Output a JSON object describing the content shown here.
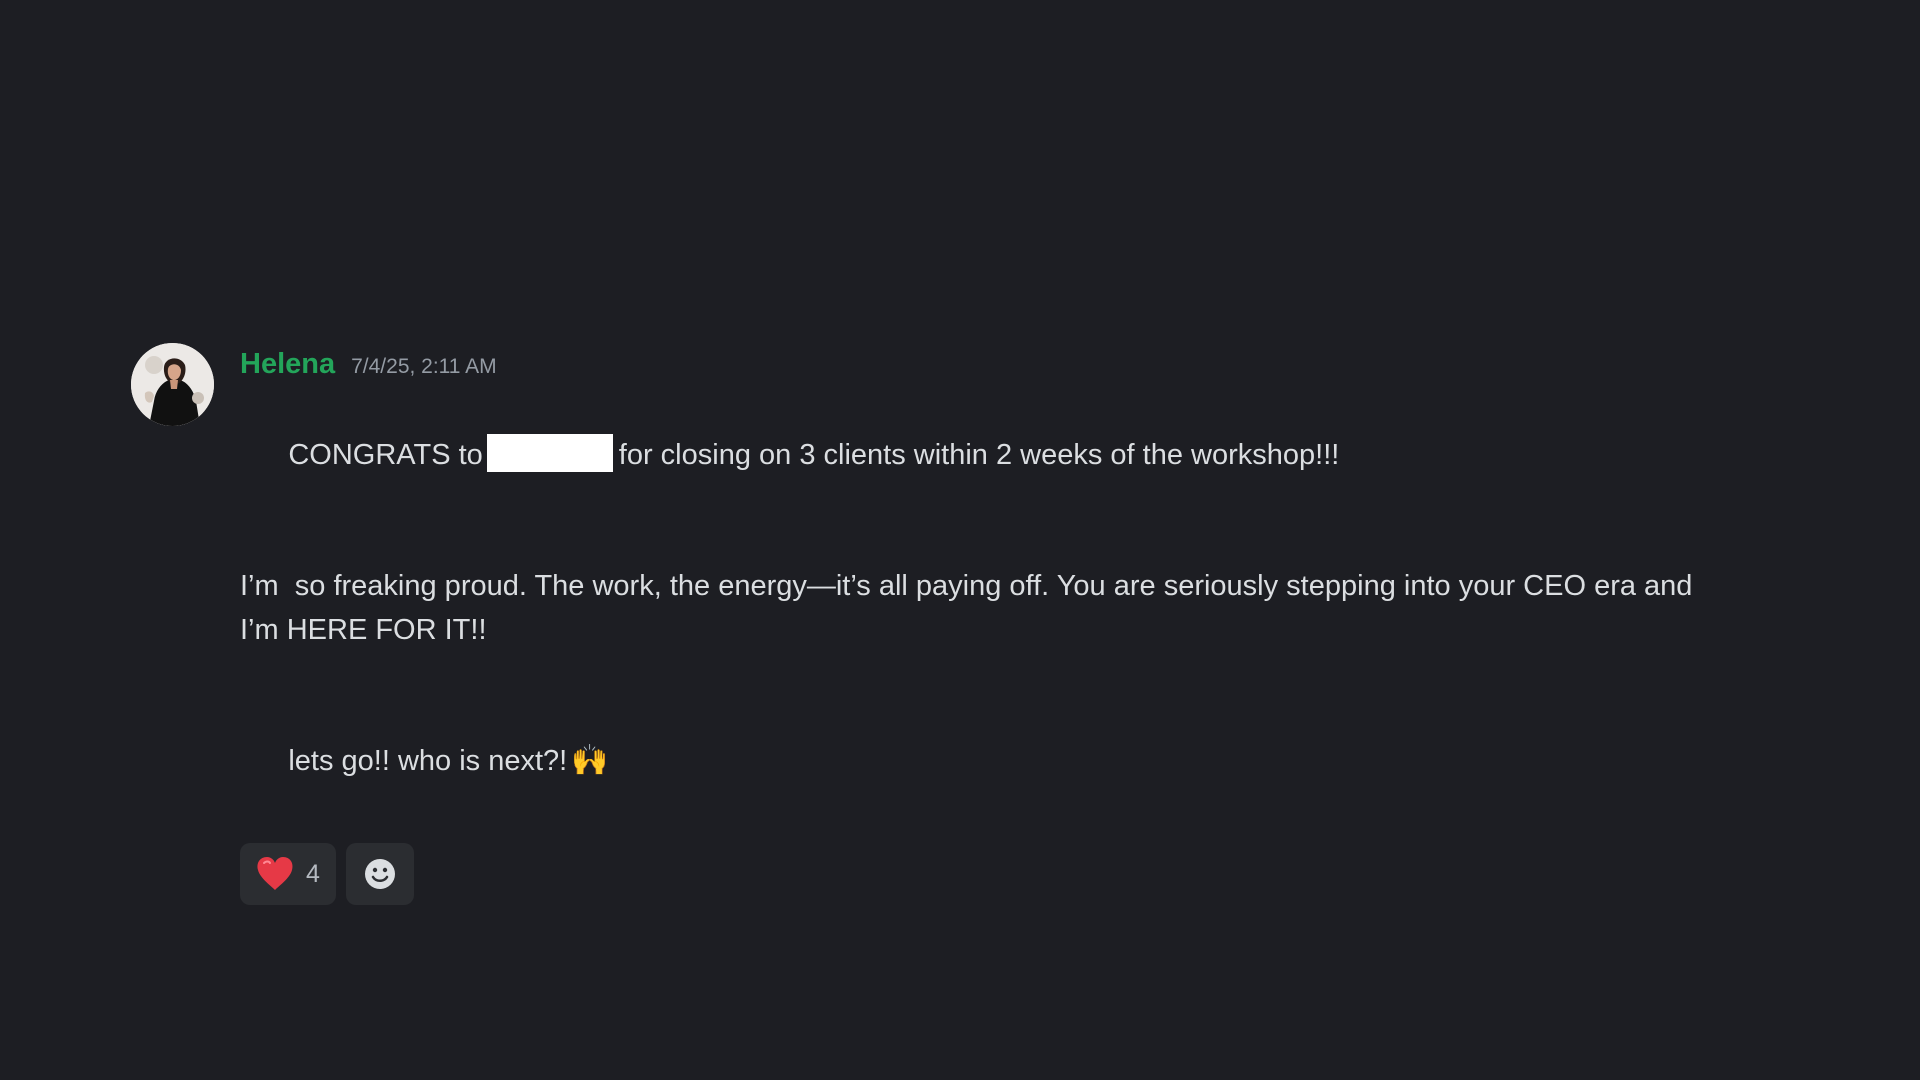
{
  "message": {
    "author": "Helena",
    "author_color": "#23a55a",
    "timestamp": "7/4/25, 2:11 AM",
    "line1_before": "CONGRATS to",
    "line1_after": "for closing on 3 clients within 2 weeks of the workshop!!!",
    "paragraph2_line1": "I’m  so freaking proud. The work, the energy—it’s all paying off. You are seriously stepping into your CEO era and",
    "paragraph2_line2": "I’m HERE FOR IT!!",
    "paragraph3": "lets go!! who is next?!",
    "paragraph3_emoji": "🙌",
    "paragraph3_emoji_name": "raised-hands-icon"
  },
  "reactions": [
    {
      "icon": "heart-icon",
      "count": "4",
      "color": "#e63946"
    },
    {
      "icon": "add-reaction-smile-icon"
    }
  ],
  "colors": {
    "background": "#1d1e23",
    "reaction_background": "#2b2d31",
    "text": "#dbdee1",
    "muted": "#949ba4"
  }
}
